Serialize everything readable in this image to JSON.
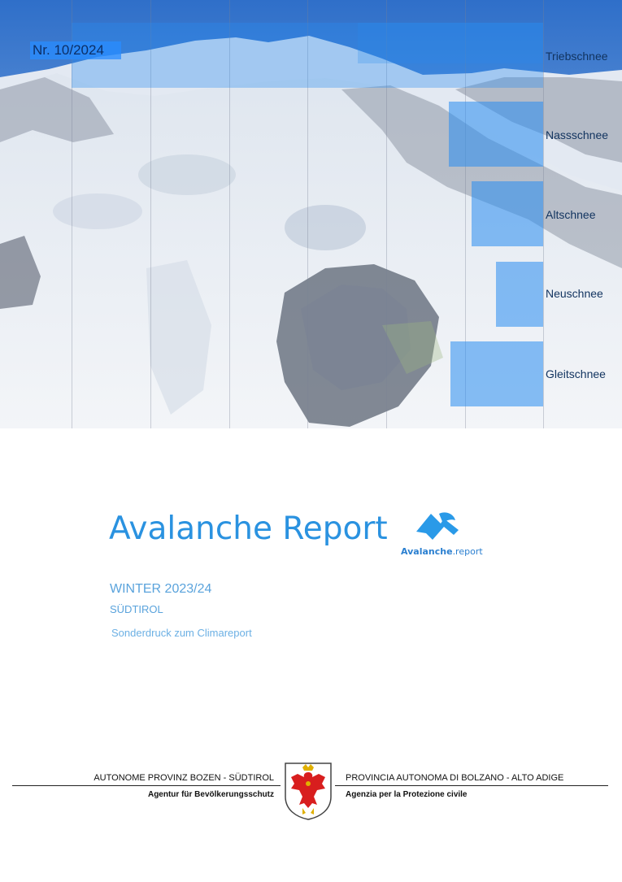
{
  "header": {
    "issue_number": "Nr. 10/2024"
  },
  "snow_categories": [
    {
      "label": "Triebschnee"
    },
    {
      "label": "Nassschnee"
    },
    {
      "label": "Altschnee"
    },
    {
      "label": "Neuschnee"
    },
    {
      "label": "Gleitschnee"
    }
  ],
  "cover": {
    "title": "Avalanche Report",
    "season": "WINTER 2023/24",
    "region": "SÜDTIROL",
    "subtitle": "Sonderdruck zum Climareport"
  },
  "logo": {
    "brand_main": "Avalanche",
    "brand_suffix": ".report",
    "icon": "avalanche-mountain-icon"
  },
  "footer": {
    "de_name": "AUTONOME PROVINZ BOZEN - SÜDTIROL",
    "de_agency": "Agentur für Bevölkerungsschutz",
    "it_name": "PROVINCIA AUTONOMA DI BOLZANO - ALTO ADIGE",
    "it_agency": "Agenzia per la Protezione civile",
    "crest_icon": "tyrolean-eagle-crest-icon"
  },
  "colors": {
    "accent": "#2a92e0",
    "overlay": "#288cf0",
    "label_dark": "#11335f"
  }
}
